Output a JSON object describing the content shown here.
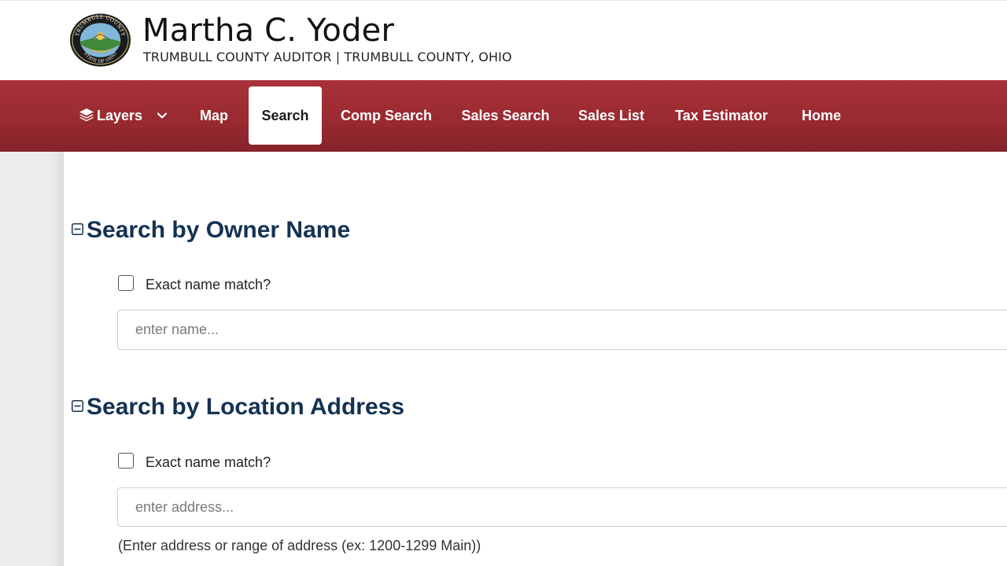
{
  "header": {
    "name": "Martha C. Yoder",
    "subtitle": "TRUMBULL COUNTY AUDITOR | TRUMBULL COUNTY, OHIO",
    "seal_top_text": "TRUMBULL COUNTY",
    "seal_bottom_text": "STATE OF OHIO"
  },
  "nav": {
    "layers": "Layers",
    "items": [
      "Map",
      "Search",
      "Comp Search",
      "Sales Search",
      "Sales List",
      "Tax Estimator",
      "Home"
    ],
    "active": "Search",
    "color": "#9a2a31"
  },
  "owner_section": {
    "title": "Search by Owner Name",
    "exact_label": "Exact name match?",
    "placeholder": "enter name...",
    "value": ""
  },
  "address_section": {
    "title": "Search by Location Address",
    "exact_label": "Exact name match?",
    "placeholder": "enter address...",
    "value": "",
    "help": "(Enter address or range of address (ex: 1200-1299 Main))"
  },
  "colors": {
    "accent": "#9a2a31",
    "heading": "#143252"
  },
  "icons": [
    "layers-icon",
    "chevron-down-icon",
    "collapse-icon",
    "county-seal-logo"
  ]
}
